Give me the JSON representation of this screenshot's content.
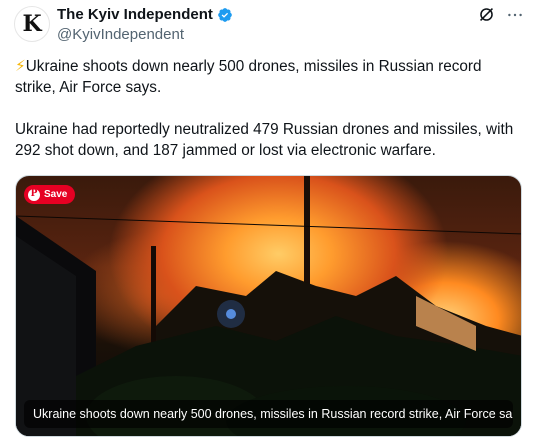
{
  "author": {
    "name": "The Kyiv Independent",
    "handle": "@KyivIndependent",
    "avatar_letter": "K",
    "verified_color": "#1d9bf0"
  },
  "top_icons": [
    "grok-icon",
    "more-icon"
  ],
  "tweet": {
    "emoji": "⚡",
    "headline": "Ukraine shoots down nearly 500 drones, missiles in Russian record strike, Air Force says.",
    "body": "Ukraine had reportedly neutralized 479 Russian drones and missiles, with 292 shot down, and 187 jammed or lost via electronic warfare."
  },
  "media": {
    "save_label": "Save",
    "caption": "Ukraine shoots down nearly 500 drones, missiles in Russian record strike, Air Force sa...",
    "pinterest_color": "#e60023"
  }
}
